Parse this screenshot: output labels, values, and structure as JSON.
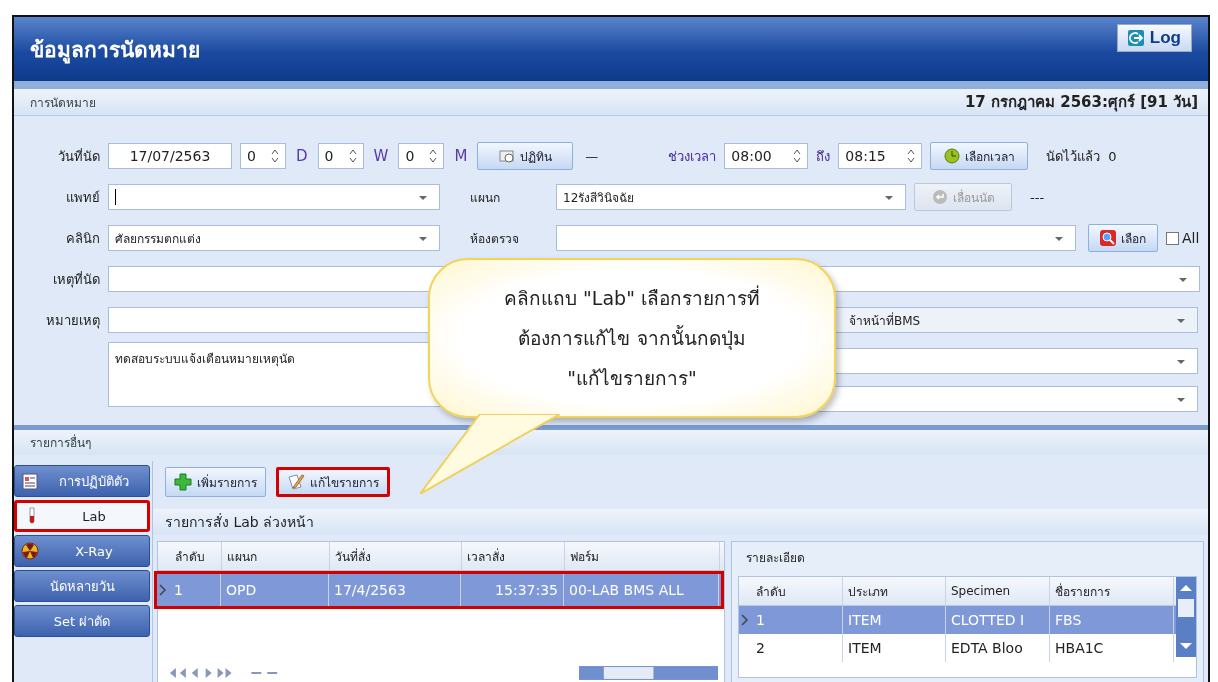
{
  "window": {
    "title": "ข้อมูลการนัดหมาย",
    "log_button": "Log"
  },
  "appointment": {
    "header": "การนัดหมาย",
    "summary": "17 กรกฎาคม 2563:ศุกร์  [91 วัน]",
    "date_label": "วันที่นัด",
    "date": "17/07/2563",
    "spins": [
      {
        "value": "0",
        "unit": "D"
      },
      {
        "value": "0",
        "unit": "W"
      },
      {
        "value": "0",
        "unit": "M"
      }
    ],
    "calendar_button": "ปฏิทิน",
    "dash": "—",
    "time_label": "ช่วงเวลา",
    "time_from": "08:00",
    "to_label": "ถึง",
    "time_to": "08:15",
    "pick_time_button": "เลือกเวลา",
    "booked_label": "นัดไว้แล้ว",
    "booked_count": "0",
    "doctor_label": "แพทย์",
    "department_label": "แผนก",
    "department": "12รังสีวินิจฉัย",
    "postpone_button": {
      "label": "เลื่อนนัด",
      "disabled": true
    },
    "postpone_note": "---",
    "clinic_label": "คลินิก",
    "clinic": "ศัลยกรรมตกแต่ง",
    "room_label": "ห้องตรวจ",
    "select_button": "เลือก",
    "all_checkbox": {
      "label": "All",
      "checked": false
    },
    "reason_label": "เหตุที่นัด",
    "note_label": "หมายเหตุ",
    "staff_field": "จ้าหน้าที่BMS",
    "note_text": "ทดสอบระบบแจ้งเตือนหมายเหตุนัด"
  },
  "others": {
    "header": "รายการอื่นๆ",
    "tabs": [
      {
        "label": "การปฏิบัติตัว",
        "selected": false,
        "highlighted": false
      },
      {
        "label": "Lab",
        "selected": true,
        "highlighted": true
      },
      {
        "label": "X-Ray",
        "selected": false,
        "highlighted": false
      },
      {
        "label": "นัดหลายวัน",
        "selected": false,
        "highlighted": false
      },
      {
        "label": "Set ผ่าตัด",
        "selected": false,
        "highlighted": false
      }
    ],
    "add_button": {
      "label": "เพิ่มรายการ",
      "highlighted": false
    },
    "edit_button": {
      "label": "แก้ไขรายการ",
      "highlighted": true
    },
    "lab_header": "รายการสั่ง Lab ล่วงหน้า",
    "lab_table": {
      "columns": [
        "ลำดับ",
        "แผนก",
        "วันที่สั่ง",
        "เวลาสั่ง",
        "ฟอร์ม"
      ],
      "rows": [
        {
          "cells": [
            "1",
            "OPD",
            "17/4/2563",
            "15:37:35",
            "00-LAB BMS ALL"
          ],
          "selected": true,
          "highlighted": true
        }
      ]
    },
    "detail": {
      "header": "รายละเอียด",
      "columns": [
        "ลำดับ",
        "ประเภท",
        "Specimen",
        "ชื่อรายการ"
      ],
      "rows": [
        {
          "cells": [
            "1",
            "ITEM",
            "CLOTTED I",
            "FBS"
          ],
          "selected": true
        },
        {
          "cells": [
            "2",
            "ITEM",
            "EDTA Bloo",
            "HBA1C"
          ],
          "selected": false
        }
      ]
    }
  },
  "callout": {
    "lines": [
      "คลิกแถบ \"Lab\" เลือกรายการที่",
      "ต้องการแก้ไข จากนั้นกดปุ่ม",
      "\"แก้ไขรายการ\""
    ]
  }
}
